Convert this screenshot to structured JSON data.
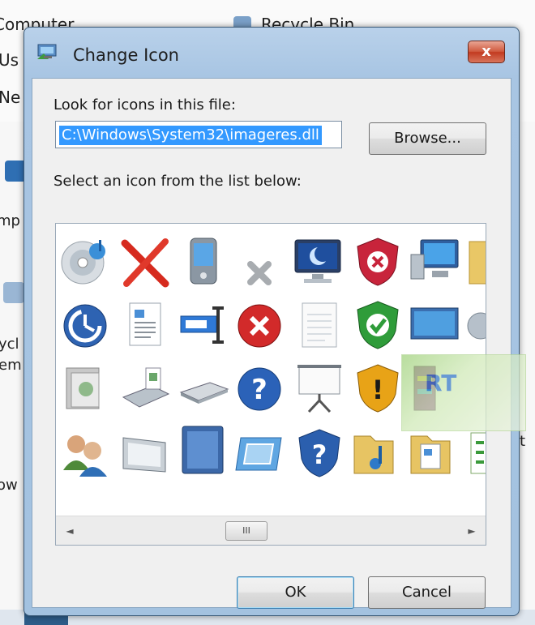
{
  "background": {
    "items": [
      "Computer",
      "Recycle Bin",
      "Us",
      "Ne",
      "mp",
      "ycl",
      "em",
      "ow",
      "t"
    ]
  },
  "dialog": {
    "title": "Change Icon",
    "close_label": "x",
    "look_label": "Look for icons in this file:",
    "path_value": "C:\\Windows\\System32\\imageres.dll",
    "browse_label": "Browse...",
    "select_label": "Select an icon from the list below:",
    "scroll_thumb": "III",
    "scroll_left": "◄",
    "scroll_right": "►",
    "ok_label": "OK",
    "cancel_label": "Cancel"
  },
  "icons": [
    [
      "cd-music-icon",
      "red-x-icon",
      "pda-icon",
      "small-x-icon",
      "monitor-moon-icon",
      "shield-error-icon",
      "network-computer-icon",
      "folder-icon"
    ],
    [
      "power-clock-icon",
      "document-text-icon",
      "rename-text-icon",
      "red-circle-x-icon",
      "blank-page-icon",
      "shield-check-icon",
      "widescreen-monitor-icon",
      "gear-icon"
    ],
    [
      "photo-album-icon",
      "scanner-icon",
      "flatbed-scanner-icon",
      "help-circle-icon",
      "projector-screen-icon",
      "shield-warning-icon",
      "winrar-icon",
      "watermark-icon"
    ],
    [
      "users-icon",
      "slim-monitor-icon",
      "film-frame-icon",
      "display-frame-icon",
      "shield-help-icon",
      "music-folder-icon",
      "document-folder-icon",
      "green-list-icon"
    ]
  ],
  "watermark": {
    "text": "RT"
  },
  "colors": {
    "selection": "#3399ff",
    "frame": "#a8c5e3"
  }
}
